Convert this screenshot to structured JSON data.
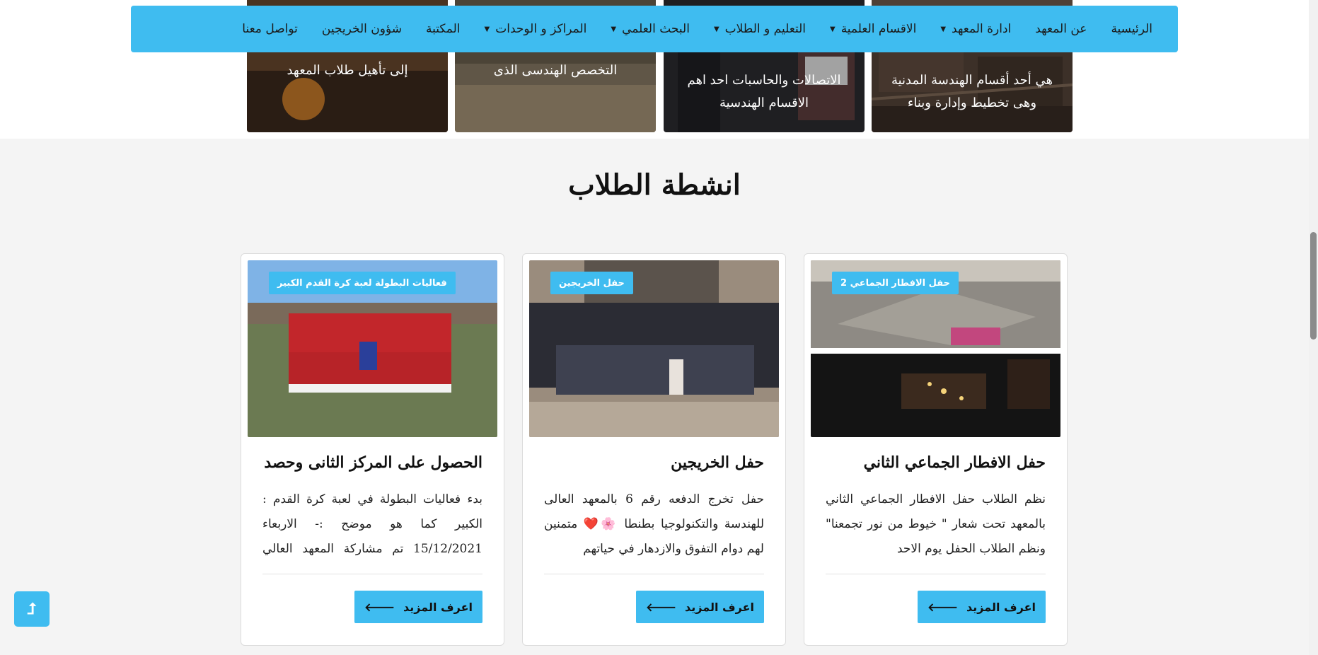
{
  "nav": {
    "items": [
      {
        "label": "الرئيسية",
        "has_dropdown": false
      },
      {
        "label": "عن المعهد",
        "has_dropdown": false
      },
      {
        "label": "ادارة المعهد",
        "has_dropdown": true
      },
      {
        "label": "الاقسام العلمية",
        "has_dropdown": true
      },
      {
        "label": "التعليم و الطلاب",
        "has_dropdown": true
      },
      {
        "label": "البحث العلمي",
        "has_dropdown": true
      },
      {
        "label": "المراكز و الوحدات",
        "has_dropdown": true
      },
      {
        "label": "المكتبة",
        "has_dropdown": false
      },
      {
        "label": "شؤون الخريجين",
        "has_dropdown": false
      },
      {
        "label": "تواصل معنا",
        "has_dropdown": false
      }
    ],
    "caret_icon": "caret-down-icon"
  },
  "departments": [
    {
      "line1": "هي أحد أقسام الهندسة المدنية",
      "line2": "وهى تخطيط وإدارة وبناء"
    },
    {
      "line1": "الاتصالات والحاسبات احد اهم",
      "line2": "الاقسام الهندسية"
    },
    {
      "line1": "التخصص الهندسى الذى",
      "line2": ""
    },
    {
      "line1": "إلى تأهيل طلاب المعهد",
      "line2": ""
    }
  ],
  "section": {
    "title": "انشطة الطلاب"
  },
  "activities": [
    {
      "badge": "حفل الافطار الجماعي 2",
      "title": "حفل الافطار الجماعي الثاني",
      "description": "نظم الطلاب حفل الافطار الجماعي الثاني بالمعهد تحت شعار \" خيوط من نور تجمعنا\" ونظم الطلاب الحفل يوم الاحد",
      "button": "اعرف المزيد"
    },
    {
      "badge": "حفل الخريجين",
      "title": "حفل الخريجين",
      "description": "حفل تخرج الدفعه رقم 6 بالمعهد العالى للهندسة والتكنولوجيا بطنطا 🌸❤️ متمنين لهم دوام التفوق والازدهار في حياتهم",
      "button": "اعرف المزيد"
    },
    {
      "badge": "فعاليات البطولة لعبة كرة القدم الكبير",
      "title": "الحصول على المركز الثانى وحصد",
      "description": "بدء فعاليات البطولة في لعبة كرة القدم : الكبير كما هو موضح :- الاربعاء 15/12/2021 تم مشاركة المعهد العالي للهندسة",
      "button": "اعرف المزيد"
    }
  ],
  "icons": {
    "arrow": "arrow-left-icon",
    "back_top": "arrow-up-icon",
    "back_top_glyph": "⮥"
  },
  "colors": {
    "accent": "#3fbcf0",
    "page_bg": "#f4f4f4"
  }
}
